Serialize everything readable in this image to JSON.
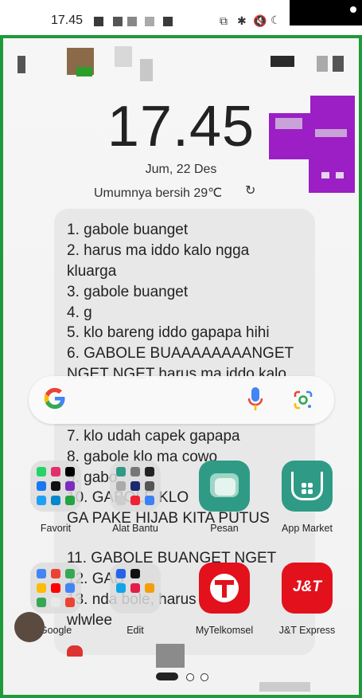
{
  "status": {
    "time": "17.45"
  },
  "lockscreen": {
    "clock": "17.45",
    "date": "Jum, 22 Des",
    "weather": "Umumnya bersih 29℃",
    "refresh_icon": "↻"
  },
  "note": {
    "lines": [
      "1. gabole buanget",
      "2. harus ma iddo kalo ngga",
      "kluarga",
      "3. gabole buanget",
      "4. g",
      "5. klo bareng iddo gapapa hihi",
      "6. GABOLE BUAAAAAAAANGET",
      "NGET NGET harus ma iddo kalo",
      "7. klo udah capek gapapa",
      "8. gabole klo ma cowo",
      "9. gabo",
      "10. GABOLE KLO",
      "GA PAKE HIJAB KITA PUTUS",
      "11. GABOLE BUANGET NGET",
      "12. GAB",
      "13. nda bole, harus",
      "wlwlee"
    ]
  },
  "search": {
    "google_icon": "google-g-icon",
    "mic_icon": "mic-icon",
    "lens_icon": "lens-icon"
  },
  "apps": {
    "row1": [
      {
        "label": "Favorit"
      },
      {
        "label": "Alat Bantu"
      },
      {
        "label": "Pesan"
      },
      {
        "label": "App Market"
      }
    ],
    "row2": [
      {
        "label": "Google"
      },
      {
        "label": "Edit"
      },
      {
        "label": "MyTelkomsel"
      },
      {
        "label": "J&T Express"
      }
    ]
  },
  "colors": {
    "frame": "#1f9a3a",
    "purple": "#9b1fc4",
    "pesan": "#2f9b86",
    "app_market": "#2f9b86",
    "telkomsel": "#e2111b",
    "jnt": "#e2111b"
  }
}
